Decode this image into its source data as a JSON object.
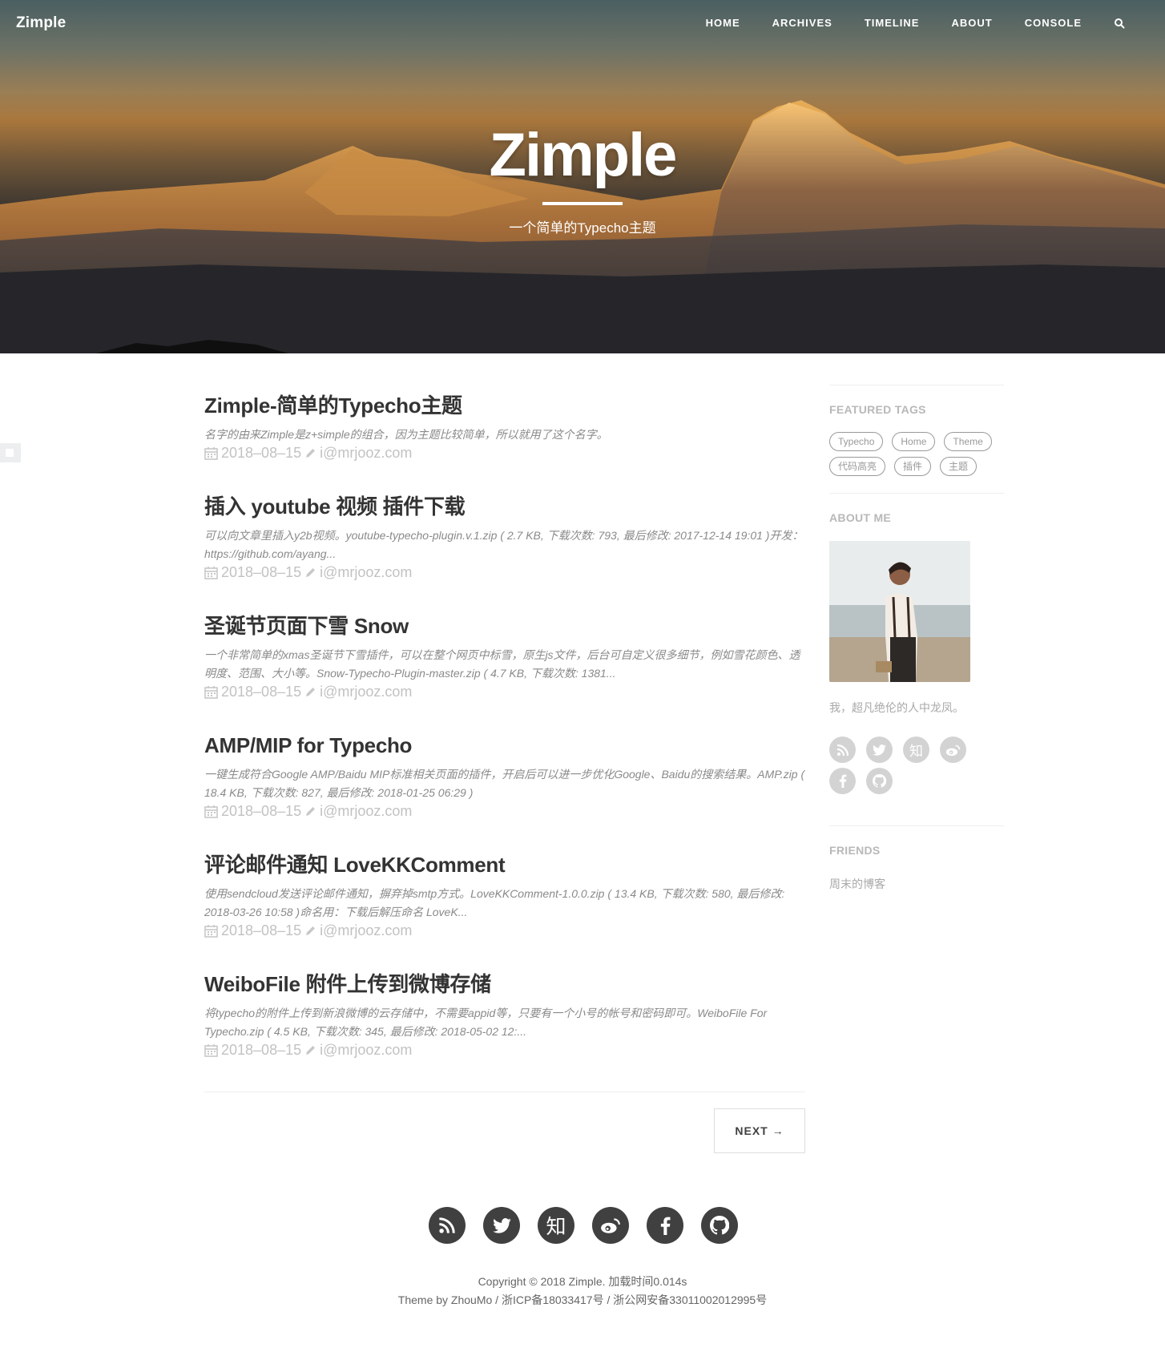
{
  "nav": {
    "brand": "Zimple",
    "items": [
      "HOME",
      "ARCHIVES",
      "TIMELINE",
      "ABOUT",
      "CONSOLE"
    ]
  },
  "hero": {
    "title": "Zimple",
    "subtitle": "一个简单的Typecho主题"
  },
  "posts": [
    {
      "title": "Zimple-简单的Typecho主题",
      "excerpt": "名字的由来Zimple是z+simple的组合，因为主题比较简单，所以就用了这个名字。",
      "date": "2018–08–15",
      "author": "i@mrjooz.com"
    },
    {
      "title": "插入 youtube 视频 插件下载",
      "excerpt": "可以向文章里插入y2b视频。youtube-typecho-plugin.v.1.zip ( 2.7 KB, 下载次数: 793, 最后修改: 2017-12-14 19:01 )开发：https://github.com/ayang...",
      "date": "2018–08–15",
      "author": "i@mrjooz.com"
    },
    {
      "title": "圣诞节页面下雪 Snow",
      "excerpt": "一个非常简单的xmas圣诞节下雪插件，可以在整个网页中标雪，原生js文件，后台可自定义很多细节，例如雪花颜色、透明度、范围、大小等。Snow-Typecho-Plugin-master.zip ( 4.7 KB, 下载次数: 1381...",
      "date": "2018–08–15",
      "author": "i@mrjooz.com"
    },
    {
      "title": "AMP/MIP for Typecho",
      "excerpt": "一键生成符合Google AMP/Baidu MIP标准相关页面的插件，开启后可以进一步优化Google、Baidu的搜索结果。AMP.zip ( 18.4 KB, 下载次数: 827, 最后修改: 2018-01-25 06:29 )",
      "date": "2018–08–15",
      "author": "i@mrjooz.com"
    },
    {
      "title": "评论邮件通知 LoveKKComment",
      "excerpt": "使用sendcloud发送评论邮件通知，摒弃掉smtp方式。LoveKKComment-1.0.0.zip ( 13.4 KB, 下载次数: 580, 最后修改: 2018-03-26 10:58 )命名用：下载后解压命名 LoveK...",
      "date": "2018–08–15",
      "author": "i@mrjooz.com"
    },
    {
      "title": "WeiboFile 附件上传到微博存储",
      "excerpt": "将typecho的附件上传到新浪微博的云存储中，不需要appid等，只要有一个小号的帐号和密码即可。WeiboFile For Typecho.zip ( 4.5 KB, 下载次数: 345, 最后修改: 2018-05-02 12:...",
      "date": "2018–08–15",
      "author": "i@mrjooz.com"
    }
  ],
  "pagination": {
    "next": "NEXT →"
  },
  "sidebar": {
    "tags_heading": "FEATURED TAGS",
    "tags": [
      "Typecho",
      "Home",
      "Theme",
      "代码高亮",
      "插件",
      "主题"
    ],
    "about_heading": "ABOUT ME",
    "about_text": "我，超凡绝伦的人中龙凤。",
    "friends_heading": "FRIENDS",
    "friends": [
      "周末的博客"
    ],
    "zhihu_glyph": "知"
  },
  "footer": {
    "zhihu_glyph": "知",
    "copyright": "Copyright © 2018 Zimple. 加载时间0.014s",
    "theme_line": "Theme by ZhouMo / 浙ICP备18033417号 / 浙公网安备33011002012995号"
  },
  "icons": [
    "rss-icon",
    "twitter-icon",
    "zhihu-icon",
    "weibo-icon",
    "facebook-icon",
    "github-icon",
    "search-icon",
    "calendar-icon",
    "pencil-icon"
  ]
}
